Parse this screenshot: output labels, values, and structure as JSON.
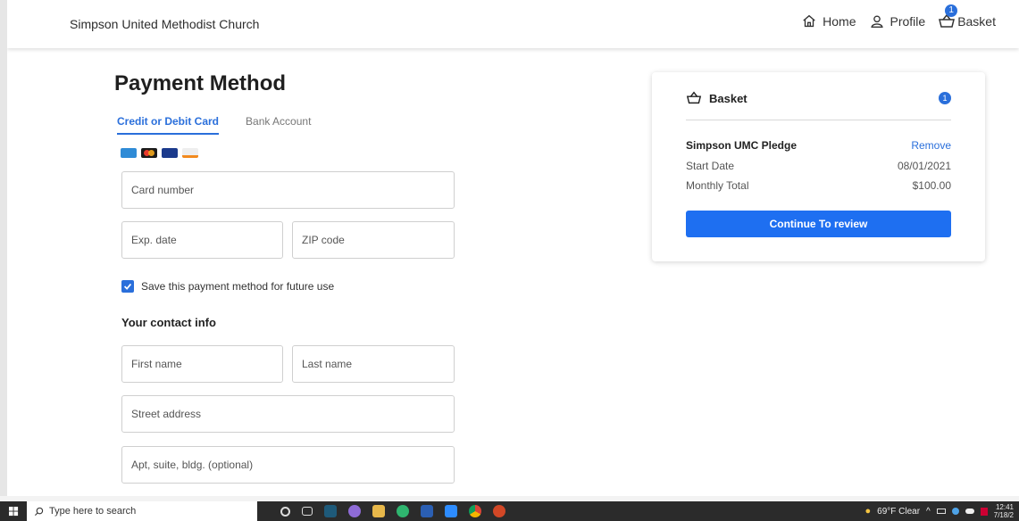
{
  "header": {
    "brand": "Simpson United Methodist Church",
    "nav": {
      "home": "Home",
      "profile": "Profile",
      "basket": "Basket",
      "basket_count": "1"
    }
  },
  "payment": {
    "title": "Payment Method",
    "tabs": [
      "Credit or Debit Card",
      "Bank Account"
    ],
    "card_brands": [
      "amex-icon",
      "mastercard-icon",
      "visa-icon",
      "discover-icon"
    ],
    "placeholders": {
      "card_number": "Card number",
      "exp_date": "Exp. date",
      "zip": "ZIP code",
      "first_name": "First name",
      "last_name": "Last name",
      "street": "Street address",
      "apt": "Apt, suite, bldg. (optional)"
    },
    "save_label": "Save this payment method for future use",
    "contact_title": "Your contact info"
  },
  "basket": {
    "title": "Basket",
    "count": "1",
    "item_name": "Simpson UMC Pledge",
    "remove_label": "Remove",
    "start_label": "Start Date",
    "start_value": "08/01/2021",
    "total_label": "Monthly Total",
    "total_value": "$100.00",
    "continue_label": "Continue To review"
  },
  "taskbar": {
    "search_placeholder": "Type here to search",
    "weather": "69°F Clear",
    "time": "12:41",
    "date": "7/18/2"
  },
  "colors": {
    "accent": "#2a6fdb",
    "button": "#1e6ff1"
  }
}
